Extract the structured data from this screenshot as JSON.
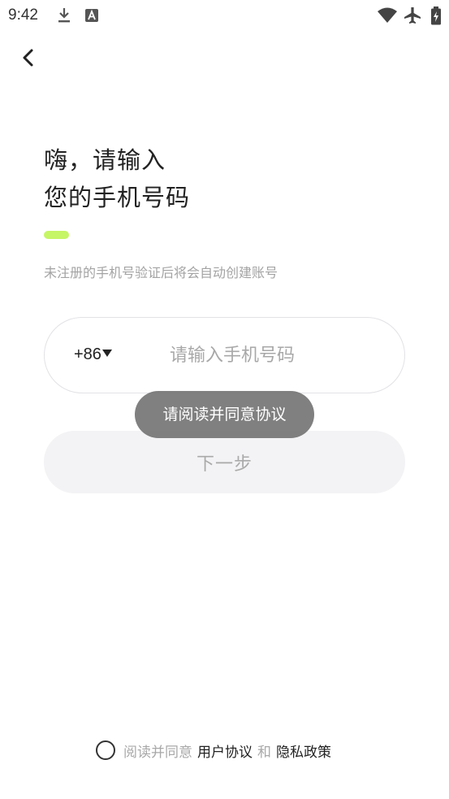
{
  "status_bar": {
    "time": "9:42",
    "icons": [
      "download-icon",
      "font-app-icon",
      "wifi-icon",
      "airplane-icon",
      "battery-charging-icon"
    ]
  },
  "header": {
    "back_icon": "back-chevron-icon"
  },
  "title": {
    "line1": "嗨，请输入",
    "line2": "您的手机号码"
  },
  "accent_color": "#c6f566",
  "subtitle": "未注册的手机号验证后将会自动创建账号",
  "phone": {
    "country_code": "+86",
    "placeholder": "请输入手机号码",
    "value": ""
  },
  "next_button": {
    "label": "下一步"
  },
  "toast": {
    "message": "请阅读并同意协议"
  },
  "agreement": {
    "prefix": "阅读并同意",
    "user_agreement": "用户协议",
    "and": "和",
    "privacy_policy": "隐私政策"
  }
}
